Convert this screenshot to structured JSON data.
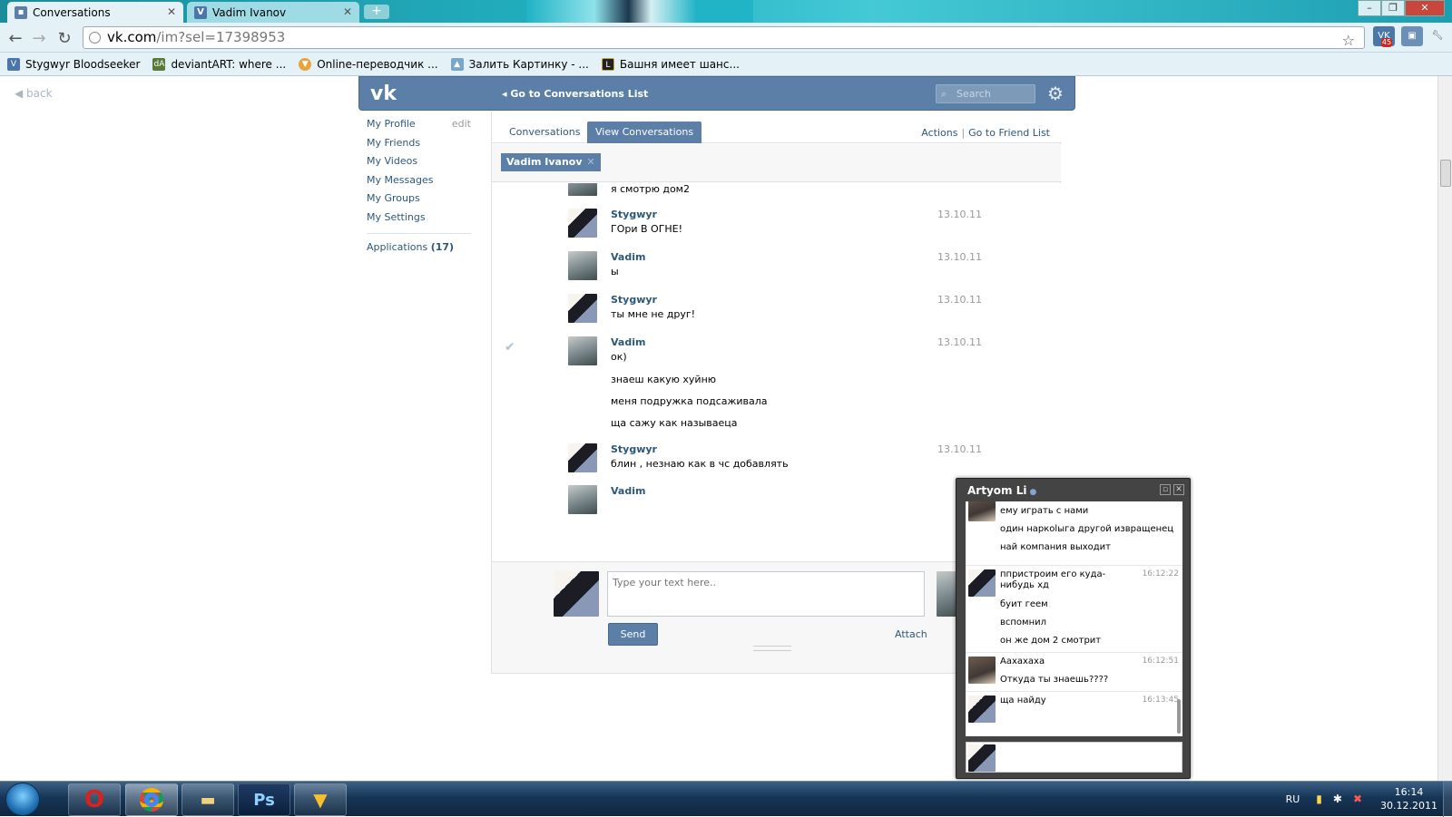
{
  "browser": {
    "tabs": [
      {
        "title": "Conversations",
        "icon": "vk-chat-icon"
      },
      {
        "title": "Vadim Ivanov",
        "icon": "vk-icon"
      }
    ],
    "url_host": "vk.com",
    "url_path": "/im?sel=17398953",
    "bookmarks": [
      {
        "label": "Stygwyr Bloodseeker",
        "icon": "vk-icon",
        "color": "#4a76a8"
      },
      {
        "label": "deviantART: where ...",
        "icon": "deviantart-icon",
        "color": "#5a7a3a"
      },
      {
        "label": "Online-переводчик ...",
        "icon": "translator-icon",
        "color": "#e8a33a"
      },
      {
        "label": "Залить Картинку - ...",
        "icon": "image-host-icon",
        "color": "#7aa6c9"
      },
      {
        "label": "Башня имеет шанс...",
        "icon": "tower-icon",
        "color": "#222"
      }
    ],
    "extension_badge": "45"
  },
  "vk": {
    "back_label": "back",
    "logo": "vk",
    "goto_conversations": "Go to Conversations List",
    "search_placeholder": "Search",
    "nav": {
      "items": [
        "My Profile",
        "My Friends",
        "My Videos",
        "My Messages",
        "My Groups",
        "My Settings"
      ],
      "edit_label": "edit",
      "applications_label": "Applications",
      "applications_count": "(17)"
    },
    "tabs": {
      "conversations": "Conversations",
      "view_conversations": "View Conversations",
      "actions": "Actions",
      "separator": "|",
      "friend_list": "Go to Friend List"
    },
    "peer_name": "Vadim Ivanov",
    "messages": [
      {
        "name": "",
        "date": "",
        "lines": [
          "я смотрю дом2"
        ]
      },
      {
        "name": "Stygwyr",
        "date": "13.10.11",
        "lines": [
          "ГОри В ОГНЕ!"
        ]
      },
      {
        "name": "Vadim",
        "date": "13.10.11",
        "lines": [
          "ы"
        ]
      },
      {
        "name": "Stygwyr",
        "date": "13.10.11",
        "lines": [
          "ты мне не друг!"
        ]
      },
      {
        "name": "Vadim",
        "date": "13.10.11",
        "lines": [
          "ок)",
          "знаеш какую хуйню",
          "меня подружка подсаживала",
          "ща сажу как называеца"
        ]
      },
      {
        "name": "Stygwyr",
        "date": "13.10.11",
        "lines": [
          "блин , незнаю как в чс добавлять"
        ]
      },
      {
        "name": "Vadim",
        "date": "13.10.11",
        "lines": [
          ""
        ]
      }
    ],
    "compose": {
      "placeholder": "Type your text here..",
      "send_label": "Send",
      "attach_label": "Attach"
    }
  },
  "chat": {
    "title": "Artyom Li",
    "messages": [
      {
        "time": "",
        "lines": [
          "ему играть с нами",
          "один наркоlыга другой извращенец",
          "най компания выходит"
        ]
      },
      {
        "time": "16:12:22",
        "lines": [
          "ппристроим его куда-нибудь хд",
          "буит геем",
          "вспомнил",
          "он же дом 2 смотрит"
        ]
      },
      {
        "time": "16:12:51",
        "lines": [
          "Аахахаха",
          "Откуда ты знаешь????"
        ]
      },
      {
        "time": "16:13:45",
        "lines": [
          "ща найду"
        ]
      }
    ]
  },
  "taskbar": {
    "apps": [
      "opera",
      "chrome",
      "explorer",
      "photoshop",
      "norton"
    ],
    "photoshop_label": "Ps",
    "lang": "RU",
    "time": "16:14",
    "date": "30.12.2011"
  },
  "colors": {
    "vk_blue": "#5b7fa6",
    "vk_link": "#2b587a",
    "chrome_frame": "#22b0c0",
    "taskbar": "#163657"
  }
}
